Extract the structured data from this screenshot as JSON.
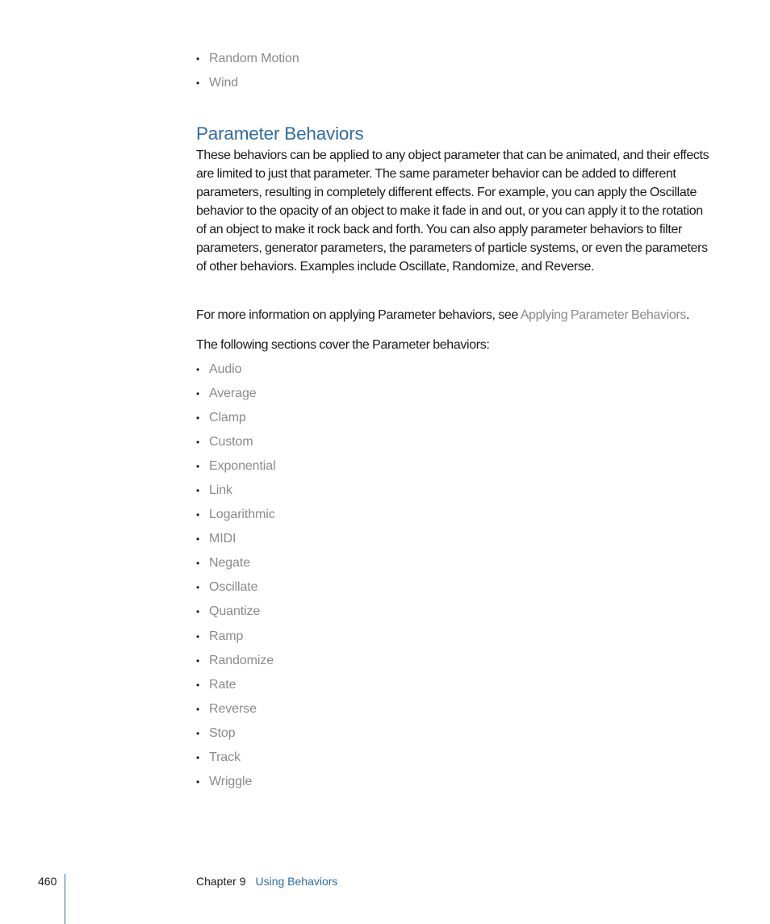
{
  "top_list": {
    "items": [
      "Random Motion",
      "Wind"
    ]
  },
  "section": {
    "heading": "Parameter Behaviors",
    "paragraph1": "These behaviors can be applied to any object parameter that can be animated, and their effects are limited to just that parameter. The same parameter behavior can be added to different parameters, resulting in completely different effects. For example, you can apply the Oscillate behavior to the opacity of an object to make it fade in and out, or you can apply it to the rotation of an object to make it rock back and forth. You can also apply parameter behaviors to filter parameters, generator parameters, the parameters of particle systems, or even the parameters of other behaviors. Examples include Oscillate, Randomize, and Reverse.",
    "paragraph2_prefix": "For more information on applying Parameter behaviors, see ",
    "paragraph2_link": "Applying Parameter Behaviors",
    "paragraph2_suffix": ".",
    "paragraph3": "The following sections cover the Parameter behaviors:"
  },
  "behavior_list": {
    "bullet": "•",
    "items": [
      "Audio",
      "Average",
      "Clamp",
      "Custom",
      "Exponential",
      "Link",
      "Logarithmic",
      "MIDI",
      "Negate",
      "Oscillate",
      "Quantize",
      "Ramp",
      "Randomize",
      "Rate",
      "Reverse",
      "Stop",
      "Track",
      "Wriggle"
    ]
  },
  "footer": {
    "page_number": "460",
    "chapter_label": "Chapter 9",
    "chapter_title": "Using Behaviors"
  },
  "colors": {
    "heading": "#2e6ca3",
    "link": "#8a8a8a",
    "body_text": "#1a1a1a",
    "footer_rule": "#2e6ca3"
  }
}
